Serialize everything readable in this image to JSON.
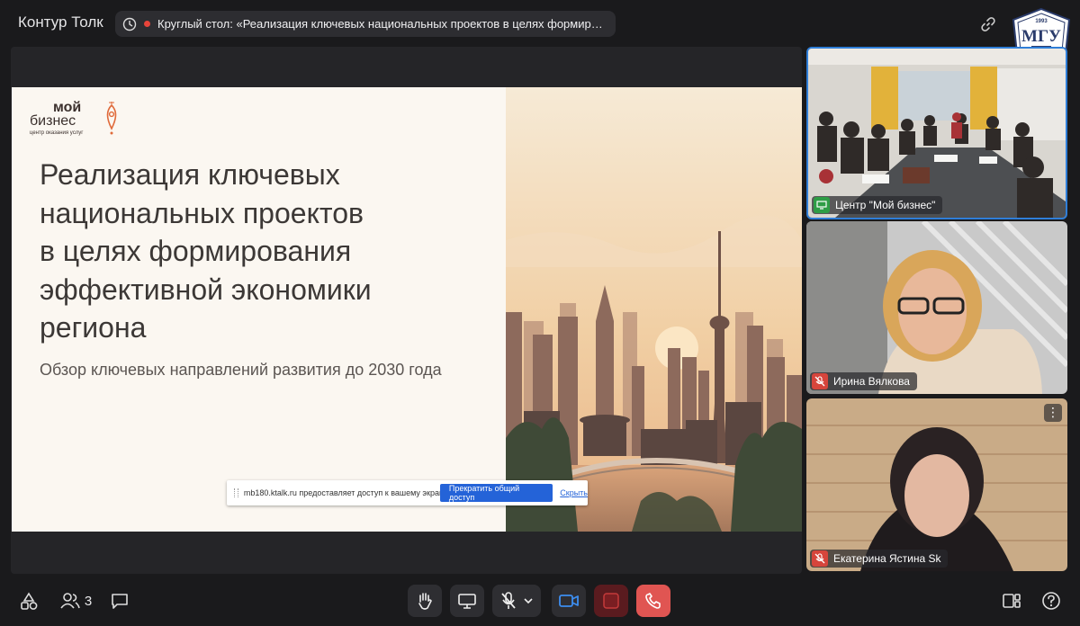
{
  "app": {
    "title": "Контур Толк"
  },
  "meeting": {
    "title": "Круглый стол: «Реализация ключевых национальных проектов в целях формир…",
    "recording": true
  },
  "corner_logo": {
    "name": "МГУ",
    "year": "1993"
  },
  "slide": {
    "brand_line1": "мой",
    "brand_line2": "бизнес",
    "brand_tagline": "центр оказания услуг",
    "title_lines": [
      "Реализация ключевых",
      "национальных проектов",
      "в целях формирования",
      "эффективной экономики",
      "региона"
    ],
    "subtitle": "Обзор ключевых направлений развития до 2030 года"
  },
  "share_banner": {
    "text": "mb180.ktalk.ru предоставляет доступ к вашему экрану.",
    "stop_label": "Прекратить общий доступ",
    "hide_label": "Скрыть"
  },
  "participants": [
    {
      "name": "Центр \"Мой бизнес\"",
      "status_icon": "screen-share-icon",
      "active": true
    },
    {
      "name": "Ирина Вялкова",
      "status_icon": "mic-off-icon",
      "active": false
    },
    {
      "name": "Екатерина Ястина Sk",
      "status_icon": "mic-off-icon",
      "active": false
    }
  ],
  "toolbar": {
    "people_count": "3",
    "buttons": [
      "apps-icon",
      "participants-icon",
      "chat-icon",
      "raise-hand-icon",
      "screen-share-icon",
      "mic-off-icon",
      "camera-icon",
      "record-icon",
      "leave-call-icon",
      "layout-icon",
      "help-icon"
    ]
  },
  "colors": {
    "accent": "#2f7ed8",
    "danger": "#e05552",
    "record": "#7a1e22",
    "background": "#1a1a1c"
  }
}
